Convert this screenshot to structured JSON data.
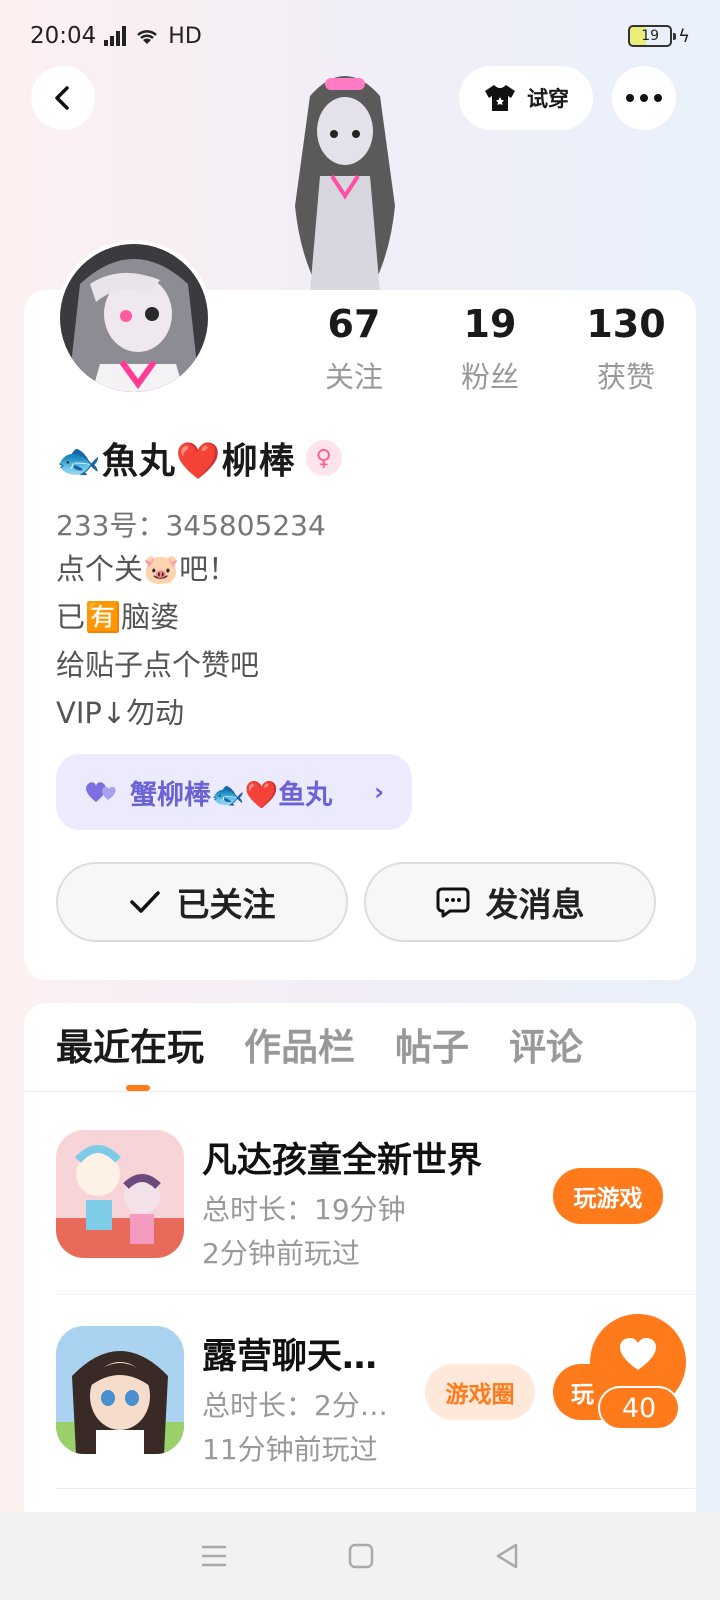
{
  "status_bar": {
    "time": "20:04",
    "network": "HD",
    "battery": "19"
  },
  "header": {
    "try_on_label": "试穿"
  },
  "profile": {
    "stats": [
      {
        "value": "67",
        "label": "关注"
      },
      {
        "value": "19",
        "label": "粉丝"
      },
      {
        "value": "130",
        "label": "获赞"
      }
    ],
    "name_prefix_emoji": "🐟",
    "name_part1": "魚丸",
    "name_heart": "❤️",
    "name_part2": "柳棒",
    "gender_symbol": "♀",
    "uid": "233号：345805234",
    "bio_lines": [
      "点个关🐷吧！",
      "已🈶脑婆",
      "给贴子点个赞吧",
      "VIP↓勿动"
    ],
    "couple_tag": "蟹柳棒🐟❤️鱼丸",
    "follow_label": "已关注",
    "message_label": "发消息"
  },
  "tabs": [
    "最近在玩",
    "作品栏",
    "帖子",
    "评论"
  ],
  "games": [
    {
      "title": "凡达孩童全新世界",
      "duration": "总时长：19分钟",
      "last_played": "2分钟前玩过",
      "play_label": "玩游戏"
    },
    {
      "title": "露营聊天…",
      "duration": "总时长：2分…",
      "last_played": "11分钟前玩过",
      "circle_label": "游戏圈",
      "play_label": "玩"
    }
  ],
  "like_fab": {
    "count": "40"
  },
  "colors": {
    "accent": "#ff7a1a",
    "couple_tag_bg": "#eceafd",
    "couple_tag_text": "#6b62d6"
  }
}
